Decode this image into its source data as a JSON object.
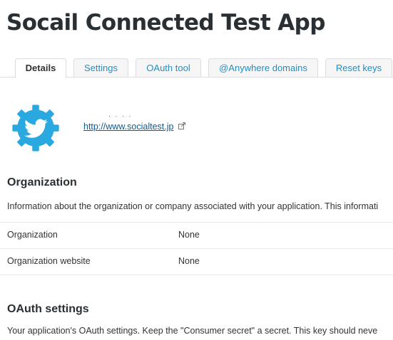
{
  "page": {
    "title": "Socail Connected Test App"
  },
  "tabs": [
    {
      "label": "Details",
      "active": true
    },
    {
      "label": "Settings",
      "active": false
    },
    {
      "label": "OAuth tool",
      "active": false
    },
    {
      "label": "@Anywhere domains",
      "active": false
    },
    {
      "label": "Reset keys",
      "active": false
    }
  ],
  "app": {
    "icon": "twitter-bird-gear-icon",
    "url": "http://www.socialtest.jp",
    "url_icon": "external-link-icon"
  },
  "organization": {
    "heading": "Organization",
    "description": "Information about the organization or company associated with your application. This informati",
    "rows": [
      {
        "key": "Organization",
        "value": "None"
      },
      {
        "key": "Organization website",
        "value": "None"
      }
    ]
  },
  "oauth": {
    "heading": "OAuth settings",
    "description": "Your application's OAuth settings. Keep the \"Consumer secret\" a secret. This key should neve"
  },
  "colors": {
    "link": "#1e8fc6",
    "logo": "#2aa9e0"
  }
}
